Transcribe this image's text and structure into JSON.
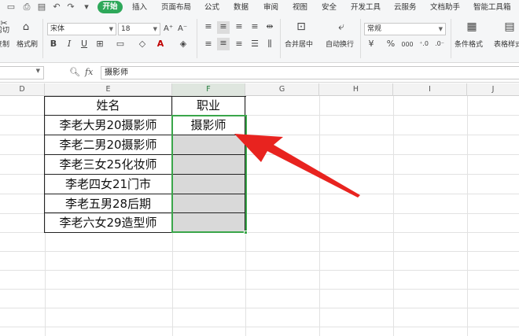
{
  "menubar": {
    "tabs": [
      "开始",
      "插入",
      "页面布局",
      "公式",
      "数据",
      "审阅",
      "视图",
      "安全",
      "开发工具",
      "云服务",
      "文档助手",
      "智能工具箱"
    ]
  },
  "ribbon": {
    "cut_label": "剪切",
    "copy_label": "复制",
    "format_painter_label": "格式刷",
    "font_name": "宋体",
    "font_size": "18",
    "bold": "B",
    "italic": "I",
    "underline": "U",
    "font_color_glyph": "A",
    "merge_center_label": "合并居中",
    "wrap_text_label": "自动换行",
    "number_format": "常规",
    "currency_symbol": "¥",
    "percent_symbol": "%",
    "thousands_symbol": "000",
    "cond_format_label": "条件格式",
    "table_style_label": "表格样式"
  },
  "formula_bar": {
    "fx_label": "fx",
    "value": "摄影师"
  },
  "sheet": {
    "columns": [
      "D",
      "E",
      "F",
      "G",
      "H",
      "I",
      "J"
    ],
    "selected_column": "F",
    "header_row": {
      "name": "姓名",
      "job": "职业"
    },
    "rows": [
      {
        "name": "李老大男20摄影师",
        "job": "摄影师"
      },
      {
        "name": "李老二男20摄影师",
        "job": ""
      },
      {
        "name": "李老三女25化妆师",
        "job": ""
      },
      {
        "name": "李老四女21门市",
        "job": ""
      },
      {
        "name": "李老五男28后期",
        "job": ""
      },
      {
        "name": "李老六女29造型师",
        "job": ""
      }
    ]
  },
  "colors": {
    "accent": "#2ea85a",
    "arrow": "#e8231f",
    "selection_border": "#3aa64a",
    "empty_cell_fill": "#d9d9d9"
  }
}
